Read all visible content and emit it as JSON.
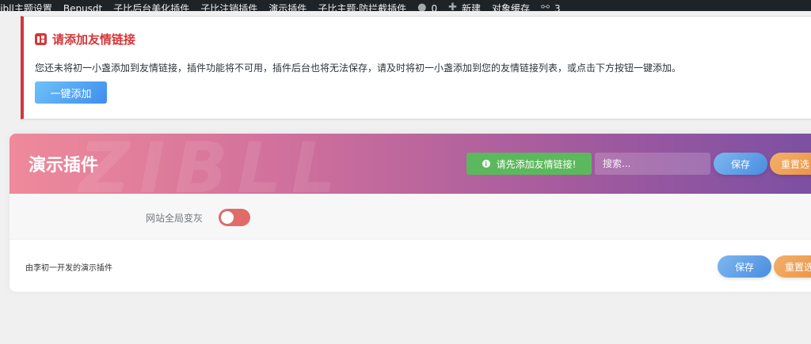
{
  "adminbar": {
    "items": [
      {
        "label": "Zibll主题设置"
      },
      {
        "label": "Bepusdt"
      },
      {
        "label": "子比后台美化插件"
      },
      {
        "label": "子比注销插件"
      },
      {
        "label": "演示插件"
      },
      {
        "label": "子比主题·防拦截插件"
      }
    ],
    "comments_count": "0",
    "new_label": "新建",
    "cache_label": "对象缓存",
    "links_count": "3"
  },
  "notice": {
    "title": "请添加友情链接",
    "text": "您还未将初一小盏添加到友情链接，插件功能将不可用，插件后台也将无法保存，请及时将初一小盏添加到您的友情链接列表，或点击下方按钮一键添加。",
    "button_label": "一键添加",
    "accent_color": "#d63638"
  },
  "panel": {
    "title": "演示插件",
    "watermark": "ZIBLL",
    "tip": "请先添加友情链接!",
    "search_placeholder": "搜索...",
    "save_label": "保存",
    "reset_label": "重置选",
    "field_label": "网站全局变灰",
    "toggle_on": false,
    "credit": "由李初一开发的演示插件"
  }
}
